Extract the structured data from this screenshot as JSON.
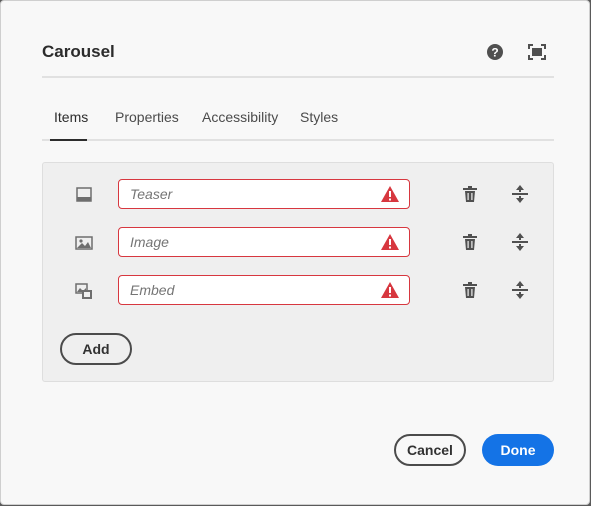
{
  "dialog": {
    "title": "Carousel",
    "header_icons": [
      "help-icon",
      "fullscreen-icon"
    ]
  },
  "tabs": [
    {
      "label": "Items",
      "active": true
    },
    {
      "label": "Properties",
      "active": false
    },
    {
      "label": "Accessibility",
      "active": false
    },
    {
      "label": "Styles",
      "active": false
    }
  ],
  "items": [
    {
      "type_icon": "teaser-icon",
      "placeholder": "Teaser",
      "invalid": true
    },
    {
      "type_icon": "image-icon",
      "placeholder": "Image",
      "invalid": true
    },
    {
      "type_icon": "embed-icon",
      "placeholder": "Embed",
      "invalid": true
    }
  ],
  "row_icons": [
    "delete-icon",
    "move-icon",
    "alert-icon"
  ],
  "add_label": "Add",
  "footer": {
    "cancel_label": "Cancel",
    "done_label": "Done"
  },
  "colors": {
    "accent": "#1473e6",
    "error": "#d7373f"
  }
}
